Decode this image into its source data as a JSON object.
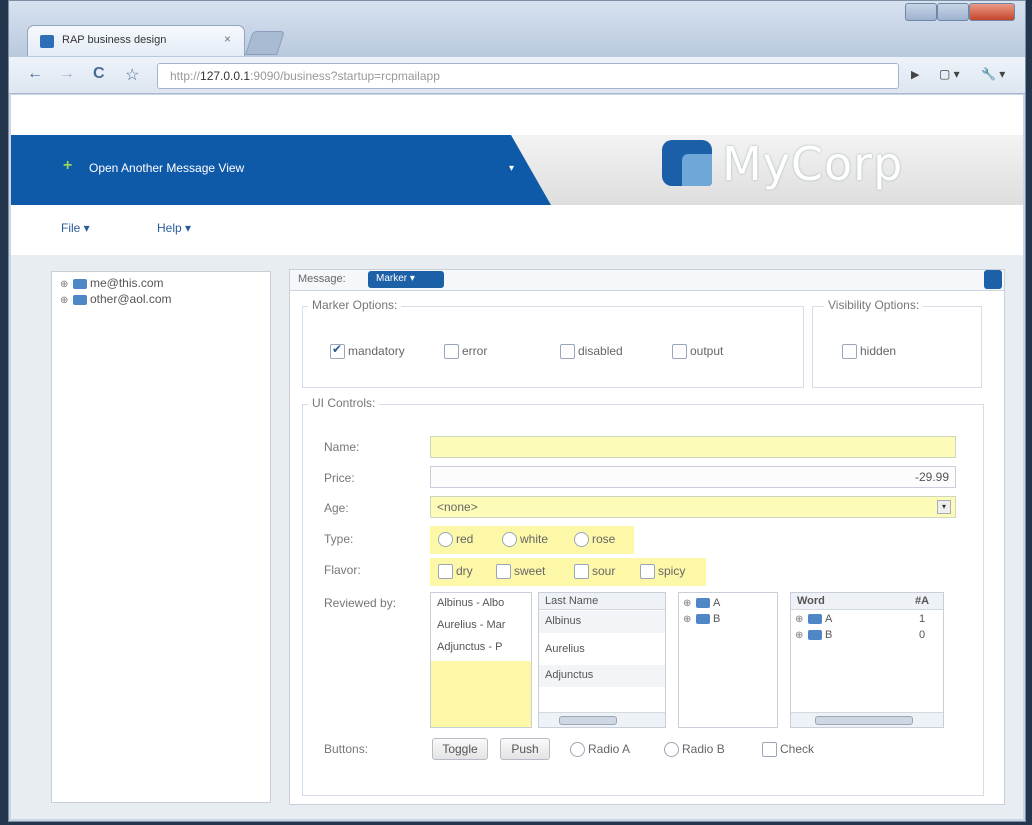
{
  "browser": {
    "tab_title": "RAP business design",
    "tab_close": "×",
    "url_prefix": "http://",
    "url_host": "127.0.0.1",
    "url_rest": ":9090/business?startup=rcpmailapp",
    "nav_back": "←",
    "nav_forward": "→",
    "nav_reload": "C",
    "nav_star": "☆",
    "menu_page": "▶",
    "menu_doc": "▢ ▾",
    "menu_tools": "🔧 ▾"
  },
  "header": {
    "open_view_icon": "+",
    "open_view_label": "Open Another Message View",
    "dropdown_glyph": "▾",
    "logo_text": "MyCorp"
  },
  "menubar": {
    "file": "File  ▾",
    "help": "Help  ▾"
  },
  "tree": [
    {
      "expander": "⊕",
      "label": "me@this.com"
    },
    {
      "expander": "⊕",
      "label": "other@aol.com"
    }
  ],
  "message": {
    "label": "Message:",
    "tag": "Marker  ▾"
  },
  "marker_options": {
    "legend": "Marker Options:",
    "items": [
      {
        "label": "mandatory",
        "checked": true
      },
      {
        "label": "error",
        "checked": false
      },
      {
        "label": "disabled",
        "checked": false
      },
      {
        "label": "output",
        "checked": false
      }
    ]
  },
  "visibility_options": {
    "legend": "Visibility Options:",
    "items": [
      {
        "label": "hidden",
        "checked": false
      }
    ]
  },
  "ui_controls": {
    "legend": "UI Controls:",
    "name_label": "Name:",
    "name_value": "",
    "price_label": "Price:",
    "price_value": "-29.99",
    "age_label": "Age:",
    "age_value": "<none>",
    "type_label": "Type:",
    "type_options": [
      "red",
      "white",
      "rose"
    ],
    "flavor_label": "Flavor:",
    "flavor_options": [
      "dry",
      "sweet",
      "sour",
      "spicy"
    ],
    "reviewed_label": "Reviewed by:",
    "reviewed_list": [
      "Albinus - Albo",
      "Aurelius - Mar",
      "Adjunctus - P"
    ],
    "lastname_header": "Last Name",
    "lastname_rows": [
      "Albinus",
      "Aurelius",
      "Adjunctus"
    ],
    "tree2_nodes": [
      "A",
      "B"
    ],
    "word_header": "Word",
    "count_header": "#A",
    "word_rows": [
      {
        "word": "A",
        "count": "1"
      },
      {
        "word": "B",
        "count": "0"
      }
    ],
    "buttons_label": "Buttons:",
    "toggle_label": "Toggle",
    "push_label": "Push",
    "radio_a": "Radio A",
    "radio_b": "Radio B",
    "check_label": "Check"
  },
  "colors": {
    "banner_blue": "#0f5aa8",
    "mandatory_yellow": "#fdfbb8"
  }
}
